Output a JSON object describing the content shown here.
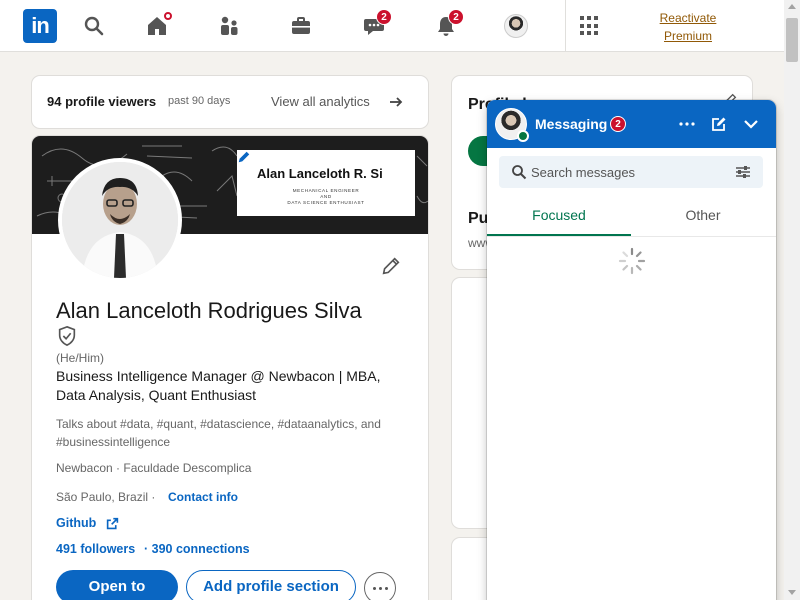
{
  "nav": {
    "logo": "in",
    "messaging_badge": "2",
    "notifications_badge": "2",
    "premium_line1": "Reactivate",
    "premium_line2": "Premium"
  },
  "analytics": {
    "viewers": "94 profile viewers",
    "period": "past 90 days",
    "view_all": "View all analytics"
  },
  "banner": {
    "name": "Alan Lanceloth R. Si",
    "line1": "MECHANICAL ENGINEER",
    "line2": "AND",
    "line3": "DATA SCIENCE ENTHUSIAST"
  },
  "profile": {
    "name": "Alan Lanceloth Rodrigues Silva",
    "pronouns": "(He/Him)",
    "headline": "Business Intelligence Manager @ Newbacon | MBA, Data Analysis, Quant Enthusiast",
    "talks_about": "Talks about #data, #quant, #datascience, #dataanalytics, and #businessintelligence",
    "company": "Newbacon · Faculdade Descomplica",
    "location": "São Paulo, Brazil ·",
    "contact_info": "Contact info",
    "github": "Github",
    "followers": "491 followers",
    "connections": "· 390 connections",
    "open_to": "Open to",
    "add_section": "Add profile section"
  },
  "right": {
    "title": "Profile l",
    "public": "Pu",
    "url": "www"
  },
  "messaging": {
    "title": "Messaging",
    "badge": "2",
    "search_placeholder": "Search messages",
    "tab_focused": "Focused",
    "tab_other": "Other"
  },
  "colors": {
    "brand": "#0a66c2",
    "badge": "#cb112d",
    "focused_tab": "#01754f",
    "premium": "#915907"
  }
}
